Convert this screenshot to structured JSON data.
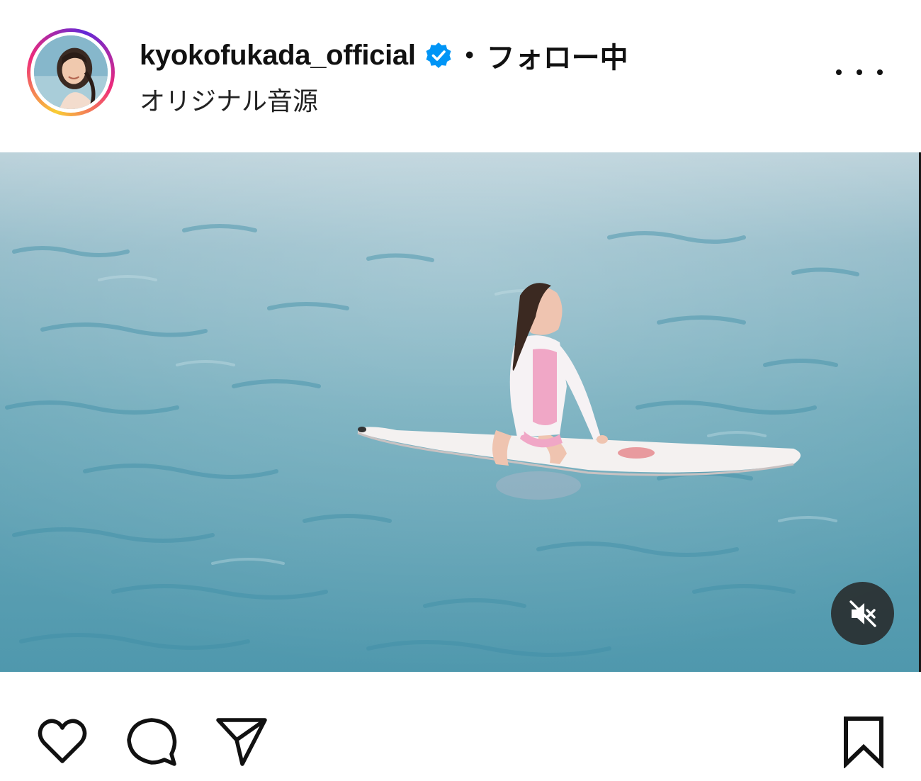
{
  "post": {
    "username": "kyokofukada_official",
    "verified": true,
    "separator": "•",
    "follow_status": "フォロー中",
    "audio": "オリジナル音源"
  },
  "icons": {
    "more": "more-options-icon",
    "verified": "verified-badge-icon",
    "mute": "speaker-muted-icon",
    "like": "heart-icon",
    "comment": "comment-bubble-icon",
    "share": "paper-plane-icon",
    "save": "bookmark-icon"
  },
  "colors": {
    "verified_blue": "#0095f6",
    "text": "#111111",
    "sea": "#5b9fb2"
  },
  "media": {
    "type": "video",
    "muted": true
  }
}
